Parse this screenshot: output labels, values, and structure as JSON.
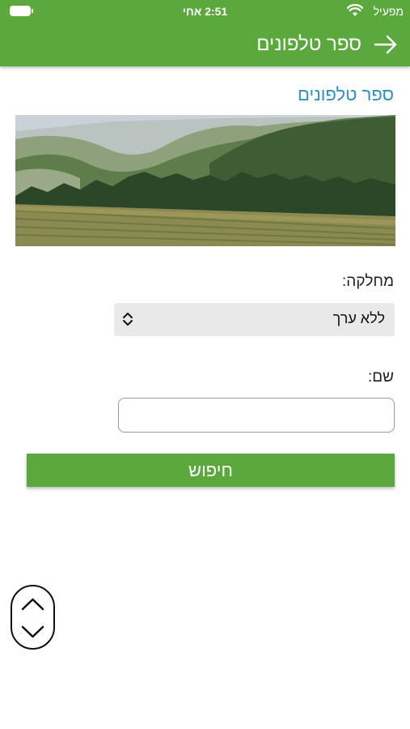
{
  "status_bar": {
    "carrier": "מפעיל",
    "time": "2:51 אחי"
  },
  "header": {
    "title": "ספר טלפונים",
    "back_icon": "arrow-right-icon",
    "color": "#5ba93c"
  },
  "page": {
    "heading": "ספר טלפונים",
    "heading_color": "#2f8fc6"
  },
  "form": {
    "department_label": "מחלקה:",
    "department_value": "ללא ערך",
    "name_label": "שם:",
    "name_value": "",
    "search_label": "חיפוש"
  },
  "scroll_control": {
    "up_icon": "chevron-up-icon",
    "down_icon": "chevron-down-icon"
  }
}
